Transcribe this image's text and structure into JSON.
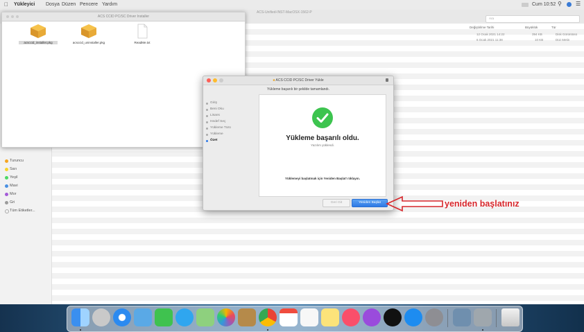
{
  "menubar": {
    "apple_icon": "apple-icon",
    "items": [
      "Yükleyici",
      "Dosya",
      "Düzen",
      "Pencere",
      "Yardım"
    ],
    "clock": "Cum 10:52"
  },
  "finder": {
    "title": "ACS-Unified-INST-MacOSX-1562-P",
    "search_placeholder": "Ara",
    "columns": {
      "date": "Değiştirilme Tarihi",
      "size": "Büyüklük",
      "kind": "Tür"
    },
    "rows": [
      {
        "date": "12 Ocak 2021 14:22",
        "size": "394 KB",
        "kind": "Disk Görüntüsü"
      },
      {
        "date": "6 Ocak 2021 11:38",
        "size": "10 KB",
        "kind": "Düz Metin"
      }
    ],
    "tags": [
      {
        "label": "Turuncu",
        "color": "#f5a623"
      },
      {
        "label": "Sarı",
        "color": "#f8d42c"
      },
      {
        "label": "Yeşil",
        "color": "#4cd964"
      },
      {
        "label": "Mavi",
        "color": "#4a90e2"
      },
      {
        "label": "Mor",
        "color": "#a45bd8"
      },
      {
        "label": "Gri",
        "color": "#9b9b9b"
      },
      {
        "label": "Tüm Etiketler...",
        "color": ""
      }
    ]
  },
  "pkg_window": {
    "title": "ACS CCID PC/SC Driver Installer",
    "files": [
      {
        "name": "acsccid_installer.pkg",
        "icon": "package-icon"
      },
      {
        "name": "acsccid_uninstaller.pkg",
        "icon": "package-icon"
      },
      {
        "name": "ReadMe.txt",
        "icon": "document-icon"
      }
    ]
  },
  "dialog": {
    "title": "ACS CCID PC/SC Driver Yükle",
    "subtitle": "Yükleme başarılı bir şekilde tamamlandı.",
    "steps": [
      "Giriş",
      "Beni Oku",
      "Lisans",
      "Hedef Seç",
      "Yükleme Türü",
      "Yükleme",
      "Özet"
    ],
    "active_step": "Özet",
    "success_title": "Yükleme başarılı oldu.",
    "success_sub": "Yazılım yüklendi.",
    "restart_note": "Yüklemeyi başlatmak için Yeniden Başlat'ı tıklayın.",
    "back_label": "Geri Git",
    "restart_label": "Yeniden Başlat"
  },
  "annotation": {
    "text": "yeniden başlatınız",
    "color": "#d7262b"
  },
  "dock": {
    "icons": [
      "finder-icon",
      "launchpad-icon",
      "safari-icon",
      "mail-icon",
      "facetime-icon",
      "messages-icon",
      "maps-icon",
      "photos-icon",
      "contacts-icon",
      "chrome-icon",
      "calendar-icon",
      "reminders-icon",
      "notes-icon",
      "music-icon",
      "podcasts-icon",
      "tv-icon",
      "appstore-icon",
      "system-preferences-icon",
      "preview-icon",
      "installer-icon",
      "trash-icon"
    ]
  }
}
